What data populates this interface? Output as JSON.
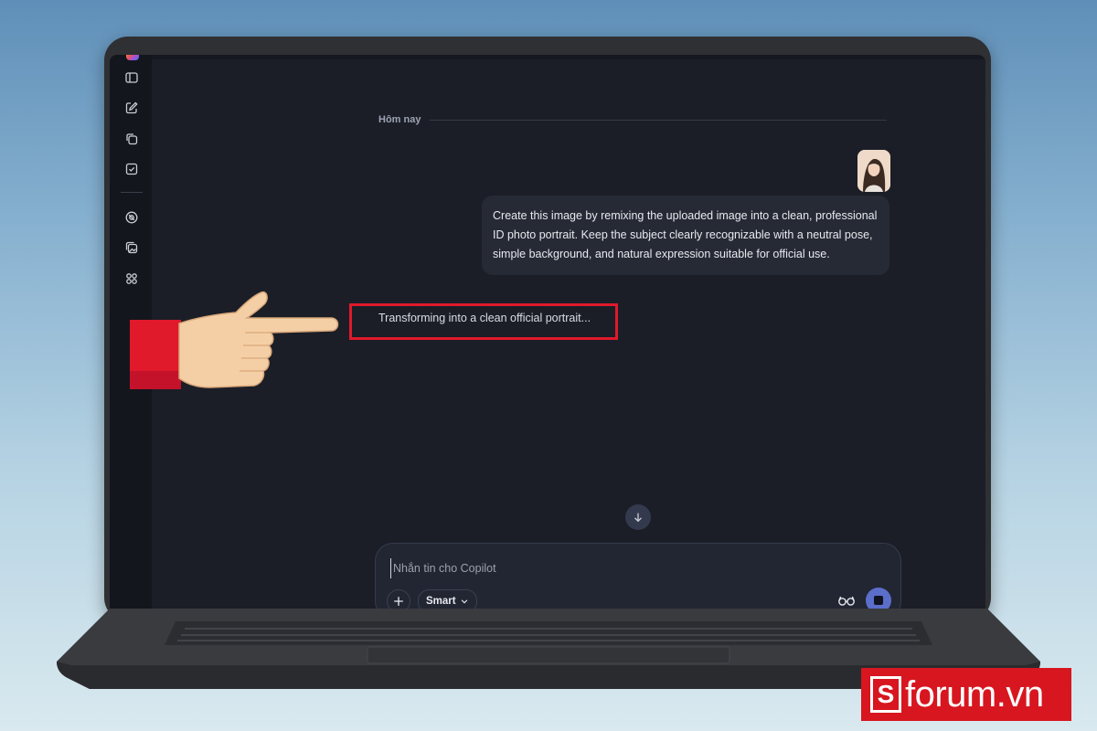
{
  "sidebar": {
    "items": [
      {
        "name": "sidebar-toggle-icon"
      },
      {
        "name": "new-chat-icon"
      },
      {
        "name": "pages-icon"
      },
      {
        "name": "tasks-icon"
      },
      {
        "name": "discover-icon"
      },
      {
        "name": "image-library-icon"
      },
      {
        "name": "apps-icon"
      }
    ]
  },
  "chat": {
    "date_label": "Hôm nay",
    "user_message": "Create this image by remixing the uploaded image into a clean, professional ID photo portrait. Keep the subject clearly recognizable with a neutral pose, simple background, and natural expression suitable for official use.",
    "status_text": "Transforming into a clean official portrait..."
  },
  "composer": {
    "placeholder": "Nhắn tin cho Copilot",
    "value": "",
    "mode_label": "Smart"
  },
  "colors": {
    "highlight": "#e0192b",
    "send_button": "#5b6ec9",
    "watermark_bg": "#d7161f"
  },
  "watermark": {
    "logo_letter": "S",
    "text": "forum.vn"
  }
}
